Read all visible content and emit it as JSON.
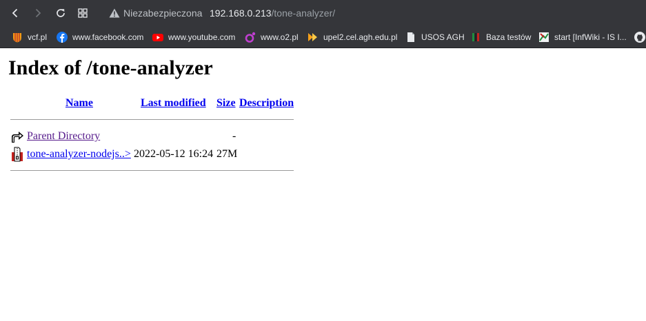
{
  "browser": {
    "security_label": "Niezabezpieczona",
    "url_host": "192.168.0.213",
    "url_path": "/tone-analyzer/",
    "icons": [
      "back-icon",
      "forward-icon",
      "reload-icon",
      "apps-grid-icon",
      "warning-icon"
    ],
    "bookmarks": [
      {
        "label": "vcf.pl",
        "icon": "vcf-favicon"
      },
      {
        "label": "www.facebook.com",
        "icon": "facebook-icon"
      },
      {
        "label": "www.youtube.com",
        "icon": "youtube-icon"
      },
      {
        "label": "www.o2.pl",
        "icon": "o2-icon"
      },
      {
        "label": "upel2.cel.agh.edu.pl",
        "icon": "moodle-icon"
      },
      {
        "label": "USOS AGH",
        "icon": "page-icon"
      },
      {
        "label": "Baza testów",
        "icon": "baza-favicon"
      },
      {
        "label": "start [InfWiki - IS I...",
        "icon": "wiki-favicon"
      }
    ]
  },
  "page": {
    "title": "Index of /tone-analyzer",
    "columns": {
      "name": "Name",
      "last_modified": "Last modified",
      "size": "Size",
      "description": "Description"
    },
    "rows": [
      {
        "name": "Parent Directory",
        "last_modified": "",
        "size": "-",
        "description": "",
        "icon": "back-folder-icon"
      },
      {
        "name": "tone-analyzer-nodejs..>",
        "last_modified": "2022-05-12 16:24",
        "size": "27M",
        "description": "",
        "icon": "compressed-file-icon"
      }
    ]
  }
}
